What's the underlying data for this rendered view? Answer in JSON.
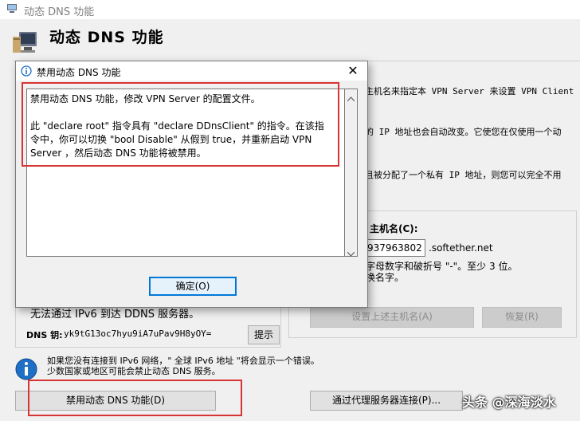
{
  "window": {
    "title": "动态 DNS 功能",
    "header_title": "动态 DNS 功能"
  },
  "background": {
    "right_line1": "主机名来指定本 VPN Server 来设置 VPN Client",
    "right_line2": "的 IP 地址也会自动改变。它使您在仅使用一个动",
    "right_line3": "且被分配了一个私有 IP 地址，则您可以完全不用",
    "hostname_label": "主机名(C):",
    "hostname_value": "937963802",
    "hostname_suffix": ".softether.net",
    "hint1": "字母数字和破折号 \"-\"。至少 3 位。",
    "hint2": "换名字。",
    "ipv6_status": "无法通过 IPv6 到达 DDNS 服务器。",
    "dns_key_label": "DNS 钥:",
    "dns_key_value": "yk9tG13oc7hyu9iA7uPav9H8yOY=",
    "show_button": "提示",
    "set_hostname_button": "设置上述主机名(A)",
    "restore_button": "恢复(R)",
    "info_line1": "如果您没有连接到 IPv6 网络，\" 全球 IPv6 地址 \"将会显示一个错误。",
    "info_line2": "少数国家或地区可能会禁止动态 DNS 服务。",
    "disable_ddns_button": "禁用动态 DNS 功能(D)",
    "proxy_button": "通过代理服务器连接(P)..."
  },
  "dialog": {
    "title": "禁用动态 DNS 功能",
    "lines": [
      "禁用动态 DNS 功能，修改 VPN Server 的配置文件。",
      "",
      "此 \"declare root\" 指令具有 \"declare DDnsClient\" 的指令。在该指",
      "令中，你可以切换 \"bool Disable\" 从假到 true，并重新启动 VPN",
      "Server ，然后动态 DNS 功能将被禁用。"
    ],
    "ok_button": "确定(O)",
    "close_glyph": "✕"
  },
  "watermark": "头条 @深海淡水",
  "icons": {
    "window": "app-monitor-icon",
    "header": "computer-monitor-icon",
    "dialog": "info-icon",
    "info": "info-circle-icon"
  }
}
